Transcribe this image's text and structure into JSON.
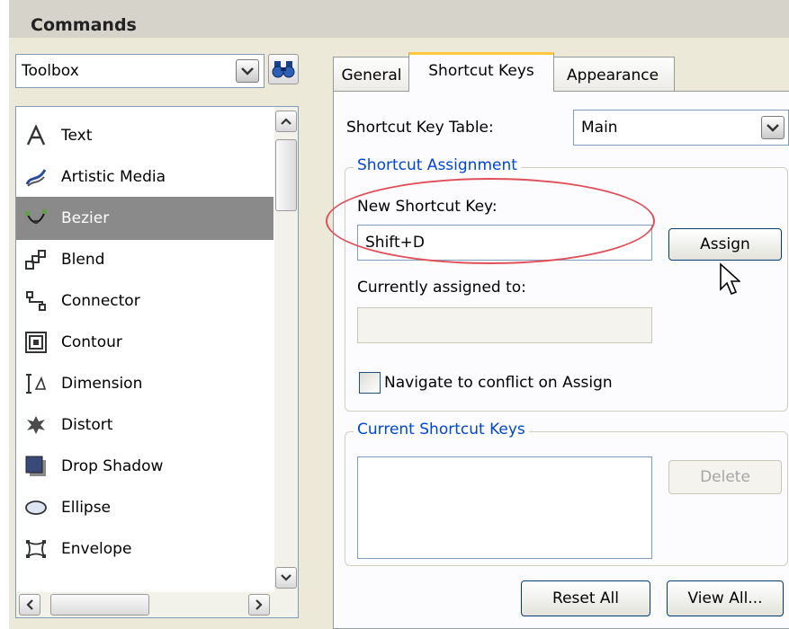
{
  "header": {
    "title": "Commands"
  },
  "category_combo": {
    "value": "Toolbox"
  },
  "command_list": {
    "items": [
      {
        "label": "Text",
        "icon": "text-tool-icon"
      },
      {
        "label": "Artistic Media",
        "icon": "artistic-media-icon"
      },
      {
        "label": "Bezier",
        "icon": "bezier-icon",
        "selected": true
      },
      {
        "label": "Blend",
        "icon": "blend-icon"
      },
      {
        "label": "Connector",
        "icon": "connector-icon"
      },
      {
        "label": "Contour",
        "icon": "contour-icon"
      },
      {
        "label": "Dimension",
        "icon": "dimension-icon"
      },
      {
        "label": "Distort",
        "icon": "distort-icon"
      },
      {
        "label": "Drop Shadow",
        "icon": "drop-shadow-icon"
      },
      {
        "label": "Ellipse",
        "icon": "ellipse-icon"
      },
      {
        "label": "Envelope",
        "icon": "envelope-icon"
      }
    ]
  },
  "tabs": [
    {
      "label": "General",
      "active": false
    },
    {
      "label": "Shortcut Keys",
      "active": true
    },
    {
      "label": "Appearance",
      "active": false
    }
  ],
  "shortcut_keys": {
    "table_label": "Shortcut Key Table:",
    "table_value": "Main",
    "assignment_group_title": "Shortcut Assignment",
    "new_key_label": "New Shortcut Key:",
    "new_key_value": "Shift+D",
    "assign_button": "Assign",
    "currently_assigned_label": "Currently assigned to:",
    "currently_assigned_value": "",
    "navigate_checkbox_label": "Navigate to conflict on Assign",
    "navigate_checked": false,
    "current_group_title": "Current Shortcut Keys",
    "delete_button": "Delete",
    "reset_all_button": "Reset All",
    "view_all_button": "View All..."
  },
  "colors": {
    "panel_bg": "#ece9d8",
    "group_title": "#0046d5",
    "selection": "#8a8a8a",
    "highlight_ellipse": "#e0505a",
    "active_tab_accent": "#ffc83c"
  }
}
